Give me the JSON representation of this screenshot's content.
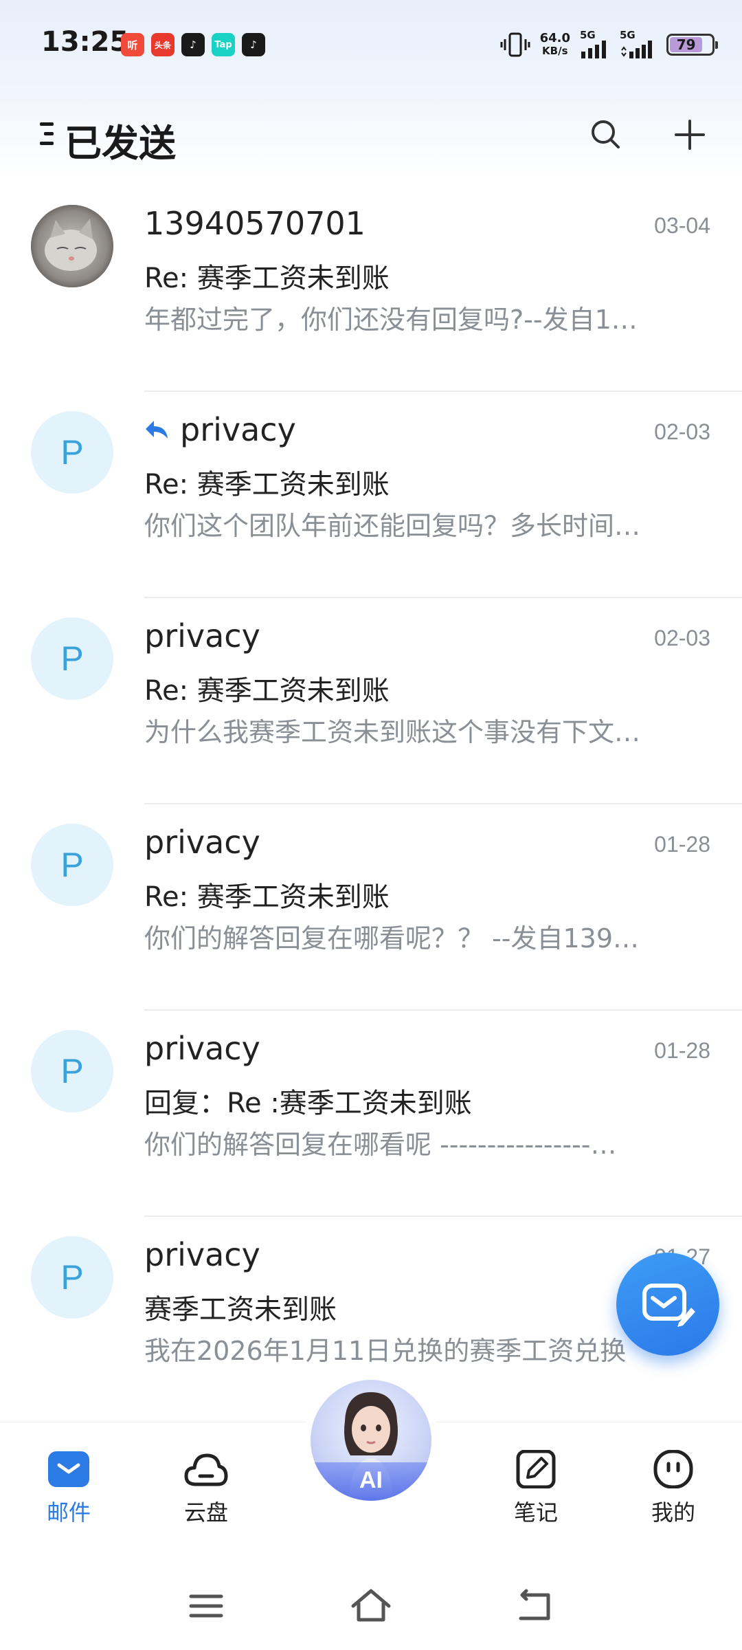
{
  "status_bar": {
    "time": "13:25",
    "apps": [
      {
        "name": "ting-app",
        "label": "听",
        "color": "#f04a3a"
      },
      {
        "name": "toutiao-app",
        "label": "头条",
        "color": "#e8392f"
      },
      {
        "name": "douyin-app",
        "label": "♪",
        "color": "#1a1a1a"
      },
      {
        "name": "taptap-app",
        "label": "Tap",
        "color": "#19d2c5"
      },
      {
        "name": "douyin-lite-app",
        "label": "♪",
        "color": "#1a1a1a"
      }
    ],
    "net_speed_value": "64.0",
    "net_speed_unit": "KB/s",
    "signal1_label": "5G",
    "signal2_label": "5G",
    "battery": "79"
  },
  "header": {
    "title": "已发送"
  },
  "mails": [
    {
      "sender": "13940570701",
      "date": "03-04",
      "subject": "Re: 赛季工资未到账",
      "preview": "年都过完了，你们还没有回复吗?--发自1…",
      "avatar": "",
      "replied": false,
      "photo": true
    },
    {
      "sender": "privacy",
      "date": "02-03",
      "subject": "Re: 赛季工资未到账",
      "preview": "你们这个团队年前还能回复吗？多长时间…",
      "avatar": "P",
      "replied": true,
      "photo": false
    },
    {
      "sender": "privacy",
      "date": "02-03",
      "subject": "Re: 赛季工资未到账",
      "preview": "为什么我赛季工资未到账这个事没有下文…",
      "avatar": "P",
      "replied": false,
      "photo": false
    },
    {
      "sender": "privacy",
      "date": "01-28",
      "subject": "Re: 赛季工资未到账",
      "preview": "你们的解答回复在哪看呢？？ --发自139…",
      "avatar": "P",
      "replied": false,
      "photo": false
    },
    {
      "sender": "privacy",
      "date": "01-28",
      "subject": "回复：Re :赛季工资未到账",
      "preview": "你们的解答回复在哪看呢 ----------------…",
      "avatar": "P",
      "replied": false,
      "photo": false
    },
    {
      "sender": "privacy",
      "date": "01-27",
      "subject": "赛季工资未到账",
      "preview": "我在2026年1月11日兑换的赛季工资兑换",
      "avatar": "P",
      "replied": false,
      "photo": false
    }
  ],
  "bottom_nav": {
    "mail": "邮件",
    "cloud": "云盘",
    "ai": "AI",
    "notes": "笔记",
    "mine": "我的"
  },
  "colors": {
    "accent": "#2c7be5",
    "avatar_bg": "#e2f3fb",
    "avatar_text": "#3aa2db"
  }
}
